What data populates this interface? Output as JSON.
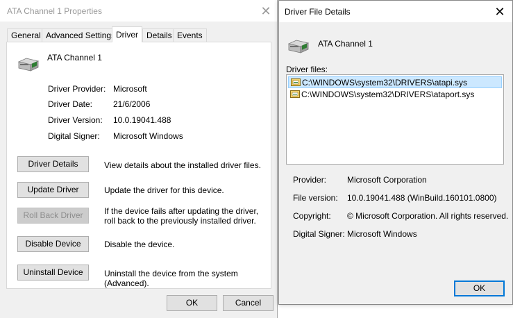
{
  "properties": {
    "title": "ATA Channel 1 Properties",
    "tabs": [
      "General",
      "Advanced Settings",
      "Driver",
      "Details",
      "Events"
    ],
    "active_tab": "Driver",
    "device_name": "ATA Channel 1",
    "info": [
      {
        "label": "Driver Provider:",
        "value": "Microsoft"
      },
      {
        "label": "Driver Date:",
        "value": "21/6/2006"
      },
      {
        "label": "Driver Version:",
        "value": "10.0.19041.488"
      },
      {
        "label": "Digital Signer:",
        "value": "Microsoft Windows"
      }
    ],
    "actions": [
      {
        "label": "Driver Details",
        "desc": "View details about the installed driver files.",
        "enabled": true
      },
      {
        "label": "Update Driver",
        "desc": "Update the driver for this device.",
        "enabled": true
      },
      {
        "label": "Roll Back Driver",
        "desc": "If the device fails after updating the driver, roll back to the previously installed driver.",
        "enabled": false
      },
      {
        "label": "Disable Device",
        "desc": "Disable the device.",
        "enabled": true
      },
      {
        "label": "Uninstall Device",
        "desc": "Uninstall the device from the system (Advanced).",
        "enabled": true
      }
    ],
    "ok_label": "OK",
    "cancel_label": "Cancel"
  },
  "details": {
    "title": "Driver File Details",
    "device_name": "ATA Channel 1",
    "files_label": "Driver files:",
    "files": [
      {
        "path": "C:\\WINDOWS\\system32\\DRIVERS\\atapi.sys",
        "selected": true
      },
      {
        "path": "C:\\WINDOWS\\system32\\DRIVERS\\ataport.sys",
        "selected": false
      }
    ],
    "fields": [
      {
        "label": "Provider:",
        "value": "Microsoft Corporation"
      },
      {
        "label": "File version:",
        "value": "10.0.19041.488 (WinBuild.160101.0800)"
      },
      {
        "label": "Copyright:",
        "value": "© Microsoft Corporation. All rights reserved."
      },
      {
        "label": "Digital Signer:",
        "value": "Microsoft Windows"
      }
    ],
    "ok_label": "OK"
  },
  "colors": {
    "selection_bg": "#cce8ff",
    "focus_border": "#0078d7"
  },
  "icons": {
    "close": "close-icon",
    "device": "ata-channel-device-icon",
    "driver_file": "driver-file-icon"
  }
}
